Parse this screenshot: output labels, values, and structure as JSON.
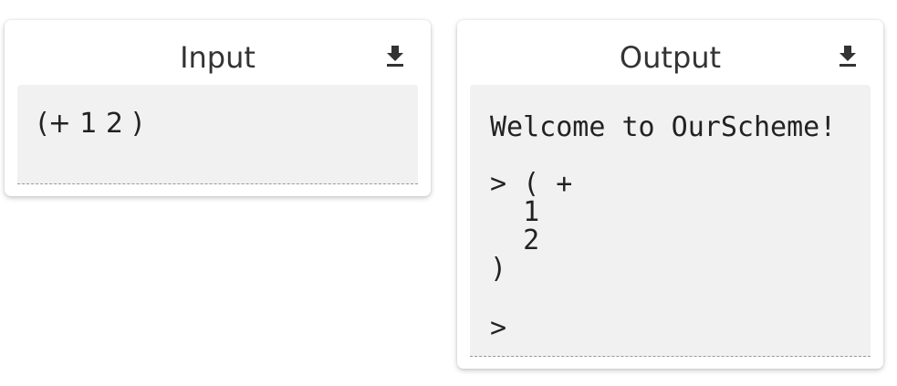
{
  "input": {
    "title": "Input",
    "download_icon": "download-icon",
    "code": "(+ 1 2 )"
  },
  "output": {
    "title": "Output",
    "download_icon": "download-icon",
    "welcome": "Welcome to OurScheme!",
    "result": "> ( +\n  1\n  2\n)",
    "prompt": ">"
  }
}
